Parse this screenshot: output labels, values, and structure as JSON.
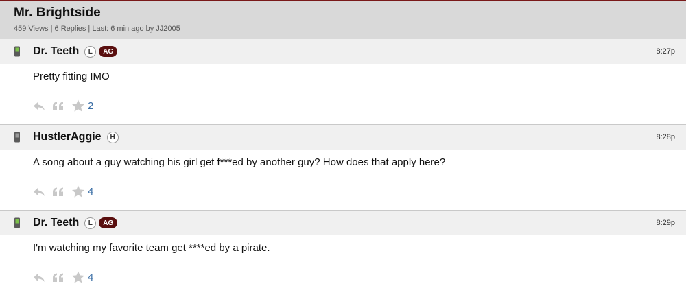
{
  "thread": {
    "title": "Mr. Brightside",
    "meta_stats": "459 Views | 6 Replies | Last: 6 min ago by ",
    "last_by": "JJ2005"
  },
  "posts": [
    {
      "username": "Dr. Teeth",
      "badge_l": "L",
      "badge_ag": "AG",
      "time": "8:27p",
      "text": "Pretty fitting IMO",
      "stars": "2"
    },
    {
      "username": "HustlerAggie",
      "badge_l": "H",
      "time": "8:28p",
      "text": "A song about a guy watching his girl get f***ed by another guy? How does that apply here?",
      "stars": "4"
    },
    {
      "username": "Dr. Teeth",
      "badge_l": "L",
      "badge_ag": "AG",
      "time": "8:29p",
      "text": "I'm watching my favorite team get ****ed by a pirate.",
      "stars": "4"
    }
  ],
  "colors": {
    "accent": "#5a0f0f",
    "header_bg": "#d9d9d9",
    "post_head_bg": "#f0f0f0",
    "link": "#3a6ea5"
  },
  "icons": [
    "mobile-device-icon",
    "reply-icon",
    "quote-icon",
    "star-icon"
  ]
}
